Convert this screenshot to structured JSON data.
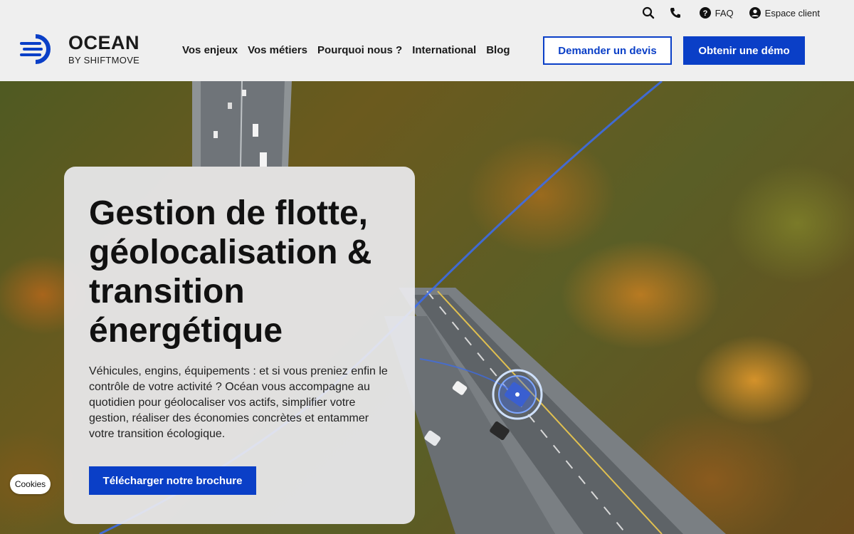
{
  "topbar": {
    "search_icon": "search-icon",
    "phone_icon": "phone-icon",
    "faq_label": "FAQ",
    "client_label": "Espace client"
  },
  "logo": {
    "name": "OCEAN",
    "sub": "BY SHIFTMOVE"
  },
  "nav": {
    "items": [
      "Vos enjeux",
      "Vos métiers",
      "Pourquoi nous ?",
      "International",
      "Blog"
    ]
  },
  "header_buttons": {
    "quote": "Demander un devis",
    "demo": "Obtenir une démo"
  },
  "hero": {
    "title": "Gestion de flotte, géolocalisation & transition énergétique",
    "description": "Véhicules, engins, équipements : et si vous preniez enfin le contrôle de votre activité ? Océan vous accompagne au quotidien pour géolocaliser vos actifs, simplifier votre gestion, réaliser des économies concrètes et entammer votre transition écologique.",
    "cta": "Télécharger notre brochure"
  },
  "cookies_label": "Cookies",
  "colors": {
    "brand_blue": "#0a3fc7",
    "header_bg": "#efefef"
  }
}
